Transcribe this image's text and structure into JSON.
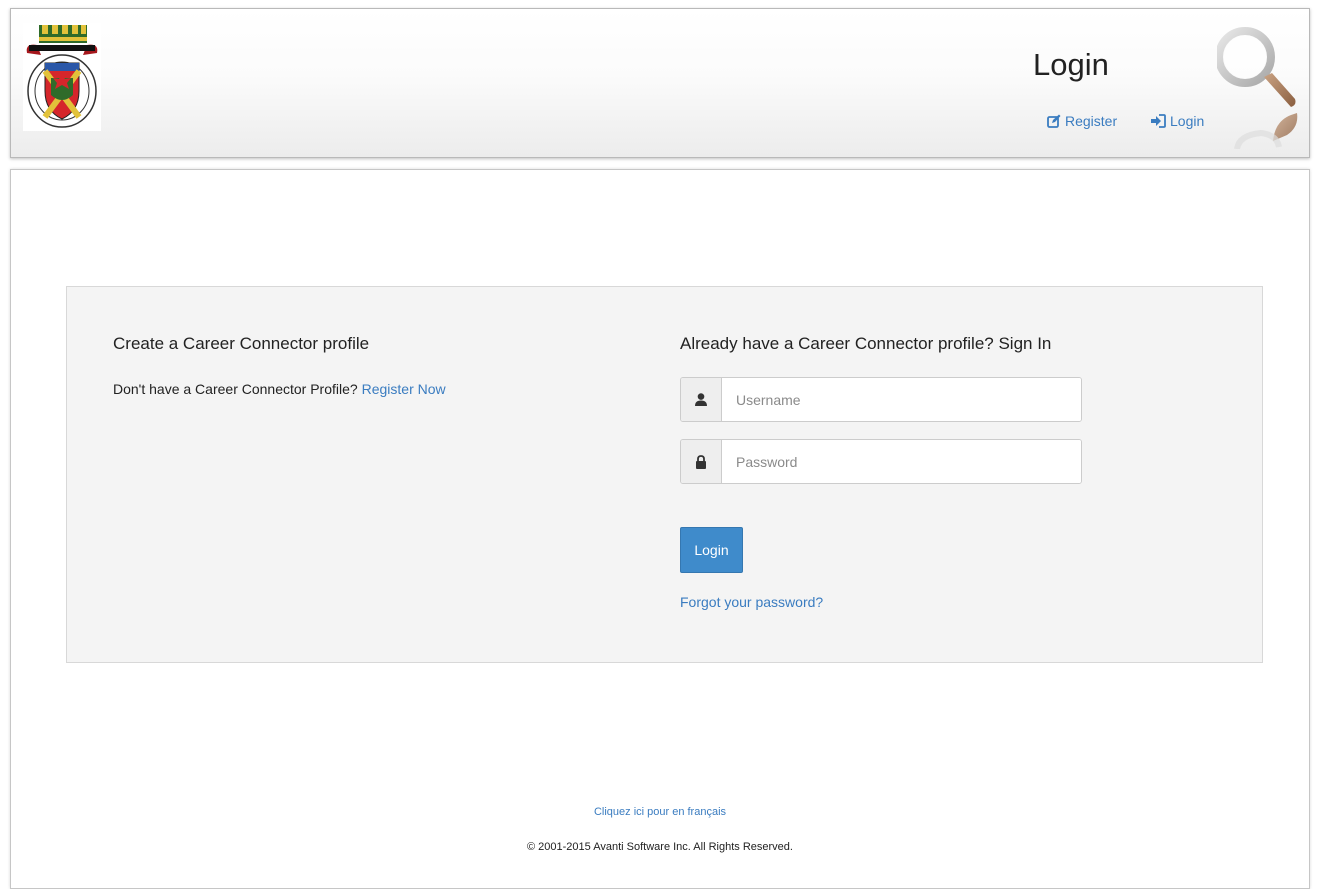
{
  "header": {
    "title": "Login",
    "register_label": "Register",
    "login_label": "Login"
  },
  "create_profile": {
    "heading": "Create a Career Connector profile",
    "prompt": "Don't have a Career Connector Profile?",
    "register_link": "Register Now"
  },
  "sign_in": {
    "heading": "Already have a Career Connector profile? Sign In",
    "username_placeholder": "Username",
    "username_value": "",
    "password_placeholder": "Password",
    "password_value": "",
    "login_button": "Login",
    "forgot_link": "Forgot your password?"
  },
  "footer": {
    "french_link": "Cliquez ici pour en français",
    "copyright": "© 2001-2015 Avanti Software Inc. All Rights Reserved."
  },
  "icons": {
    "crest": "municipal-crest-logo",
    "magnifier": "magnifier-icon",
    "register": "edit-icon",
    "login": "login-icon",
    "username": "user-icon",
    "password": "lock-icon"
  },
  "colors": {
    "link": "#3a7cc0",
    "primary_button": "#3f8bcb",
    "panel_background": "#f4f4f4"
  }
}
